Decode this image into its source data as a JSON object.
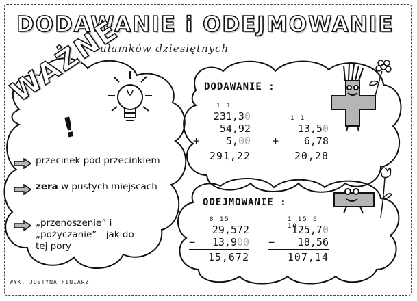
{
  "title": {
    "main": "DODAWANIE i ODEJMOWANIE",
    "sub": "ułamków dziesiętnych"
  },
  "important": {
    "label": "WAŻNE",
    "mark": "!",
    "rules": [
      {
        "text": "przecinek pod przecinkiem"
      },
      {
        "bold": "zera",
        "text": " w pustych miejscach"
      },
      {
        "text": "„przenoszenie” i „pożyczanie” - jak do tej pory"
      }
    ]
  },
  "addition": {
    "heading": "DODAWANIE :",
    "examples": [
      {
        "carry": "1 1",
        "rows": [
          {
            "op": "",
            "value": "231,3",
            "grey": "0"
          },
          {
            "op": "",
            "value": "54,92",
            "grey": ""
          },
          {
            "op": "+",
            "value": "5,",
            "grey": "00"
          }
        ],
        "result": "291,22"
      },
      {
        "carry": "1 1",
        "rows": [
          {
            "op": "",
            "value": "13,5",
            "grey": "0"
          },
          {
            "op": "+",
            "value": "6,78",
            "grey": ""
          }
        ],
        "result": "20,28"
      }
    ]
  },
  "subtraction": {
    "heading": "ODEJMOWANIE :",
    "examples": [
      {
        "carry": "8 15",
        "rows": [
          {
            "op": "",
            "value": "29,572",
            "grey": ""
          },
          {
            "op": "−",
            "value": "13,9",
            "grey": "00"
          }
        ],
        "result": "15,672"
      },
      {
        "carry": "1 15 6 10",
        "rows": [
          {
            "op": "",
            "value": "125,7",
            "grey": "0"
          },
          {
            "op": "−",
            "value": "18,56",
            "grey": ""
          }
        ],
        "result": "107,14"
      }
    ]
  },
  "footer": "WYK. JUSTYNA   FINIARZ",
  "icons": [
    "lightbulb-icon",
    "plus-character-icon",
    "minus-character-icon",
    "flower-icon",
    "arrow-right-icon"
  ]
}
